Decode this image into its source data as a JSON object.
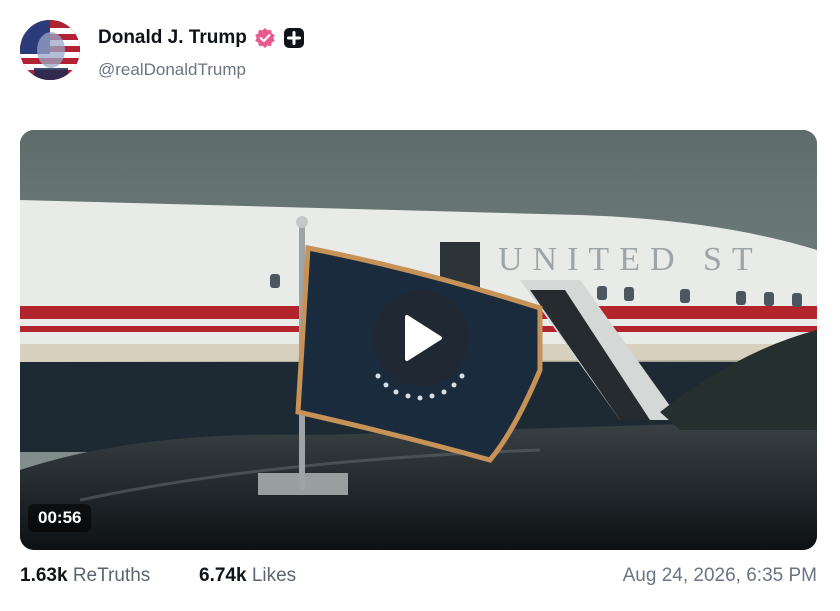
{
  "post": {
    "display_name": "Donald J. Trump",
    "handle": "@realDonaldTrump",
    "verified_icon": "verified-badge-icon",
    "subscription_icon": "plus-square-icon",
    "accent_color": "#e85a8c"
  },
  "media": {
    "type": "video",
    "duration": "00:56",
    "play_icon": "play-icon",
    "aircraft_lettering": "UNITED ST"
  },
  "stats": {
    "retruths_count": "1.63k",
    "retruths_label": "ReTruths",
    "likes_count": "6.74k",
    "likes_label": "Likes"
  },
  "timestamp": "Aug 24, 2026, 6:35 PM"
}
